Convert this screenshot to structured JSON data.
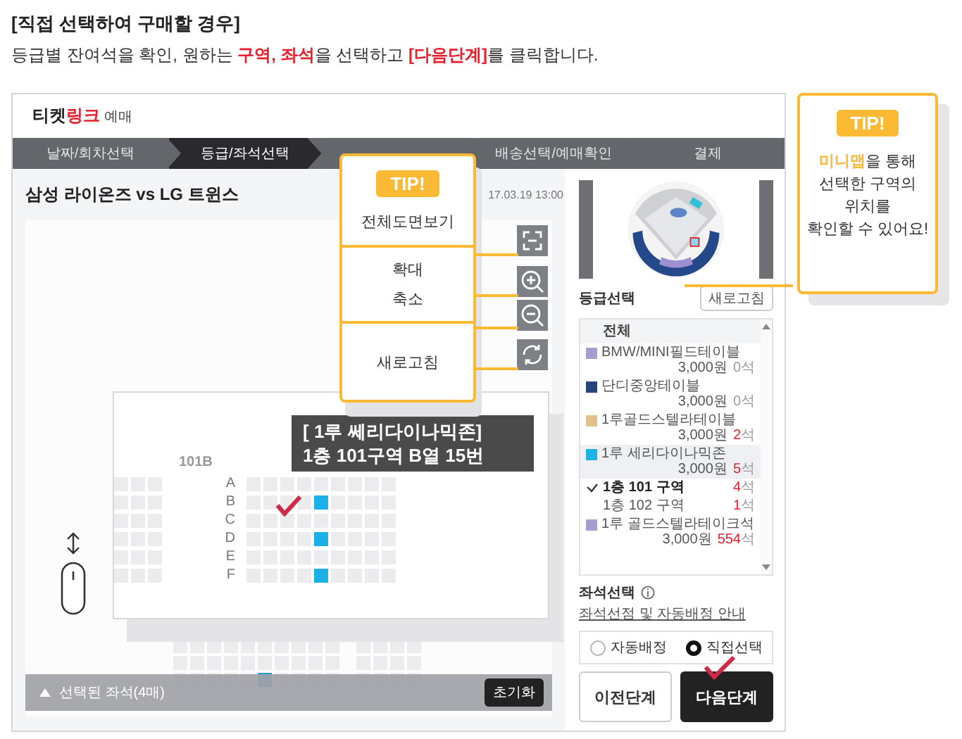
{
  "instruction": {
    "title": "[직접 선택하여 구매할 경우]",
    "text": "등급별 잔여석을 확인, 원하는 **구역, 좌석**을 선택하고 **[다음단계]**를 클릭합니다."
  },
  "site": {
    "logo": "티켓**링크**",
    "logo_caption": "예매"
  },
  "steps": [
    {
      "label": "날짜/회차선택",
      "selected": false
    },
    {
      "label": "등급/좌석선택",
      "selected": true
    },
    {
      "selected": false
    },
    {
      "label": "배송선택/예매확인",
      "selected": false
    },
    {
      "label": "결제",
      "selected": false
    }
  ],
  "event": {
    "title": "삼성 라이온즈 vs LG 트윈스",
    "datetime": "17.03.19 13:00"
  },
  "map_tools_tip": {
    "badge": "TIP!",
    "groups": [
      [
        "전체도면보기"
      ],
      [
        "확대",
        "축소"
      ],
      [
        "새로고침"
      ]
    ]
  },
  "map_tools": [
    {
      "kind": "fullscreen"
    },
    {
      "kind": "zoom-in"
    },
    {
      "kind": "zoom-out"
    },
    {
      "kind": "refresh"
    }
  ],
  "seat_map": {
    "section": "101B",
    "rows": [
      {
        "label": "A",
        "seats": [
          false,
          false,
          false,
          false,
          false,
          false,
          false,
          false,
          false
        ]
      },
      {
        "label": "B",
        "seats": [
          false,
          false,
          false,
          false,
          true,
          false,
          false,
          false,
          false
        ]
      },
      {
        "label": "C",
        "seats": [
          false,
          false,
          false,
          false,
          false,
          false,
          false,
          false,
          false
        ]
      },
      {
        "label": "D",
        "seats": [
          false,
          false,
          false,
          false,
          true,
          false,
          false,
          false,
          false
        ]
      },
      {
        "label": "E",
        "seats": [
          false,
          false,
          false,
          false,
          false,
          false,
          false,
          false,
          false
        ]
      },
      {
        "label": "F",
        "seats": [
          false,
          false,
          false,
          false,
          true,
          false,
          false,
          false,
          false
        ]
      }
    ]
  },
  "seat_tooltip": {
    "zone": "[ 1루 쎄리다이나믹존]",
    "seat": "1층 101구역 B열 15번"
  },
  "selection_bar": {
    "label": "선택된 좌석(4매)",
    "reset": "초기화"
  },
  "minimap_tip": {
    "badge": "TIP!",
    "text": "**미니맵**을 통해\n선택한 구역의\n위치를\n확인할 수 있어요!"
  },
  "grade_panel": {
    "title": "등급선택",
    "refresh": "새로고침",
    "items": [
      {
        "kind": "all",
        "name": "전체",
        "selected": false
      },
      {
        "kind": "grade",
        "name": "BMW/MINI필드테이블",
        "price": "3,000원",
        "count": "0석",
        "color": "#a99ccf",
        "selected": false
      },
      {
        "kind": "grade",
        "name": "단디중앙테이블",
        "price": "3,000원",
        "count": "0석",
        "color": "#24467a",
        "selected": false
      },
      {
        "kind": "grade",
        "name": "1루골드스텔라테이블",
        "price": "3,000원",
        "count": "**2**석",
        "color": "#e3bf8c",
        "selected": false
      },
      {
        "kind": "grade",
        "name": "1루 세리다이나믹존",
        "price": "3,000원",
        "count": "**5**석",
        "color": "#1cb4e6",
        "selected": true
      },
      {
        "kind": "zone",
        "name": "1층 101 구역",
        "count": "**4**석",
        "checked": true
      },
      {
        "kind": "zone",
        "name": "1층 102 구역",
        "count": "**1**석",
        "checked": false
      },
      {
        "kind": "grade",
        "name": "1루 골드스텔라테이크석",
        "price": "3,000원",
        "count": "**554**석",
        "color": "#a99ccf",
        "selected": false
      }
    ]
  },
  "seat_select": {
    "title": "좌석선택",
    "info_link": "좌석선점 및 자동배정 안내",
    "options": [
      {
        "label": "자동배정",
        "selected": false
      },
      {
        "label": "직접선택",
        "selected": true
      }
    ]
  },
  "buttons": [
    {
      "label": "이전단계",
      "kind": "secondary"
    },
    {
      "label": "다음단계",
      "kind": "primary"
    }
  ]
}
